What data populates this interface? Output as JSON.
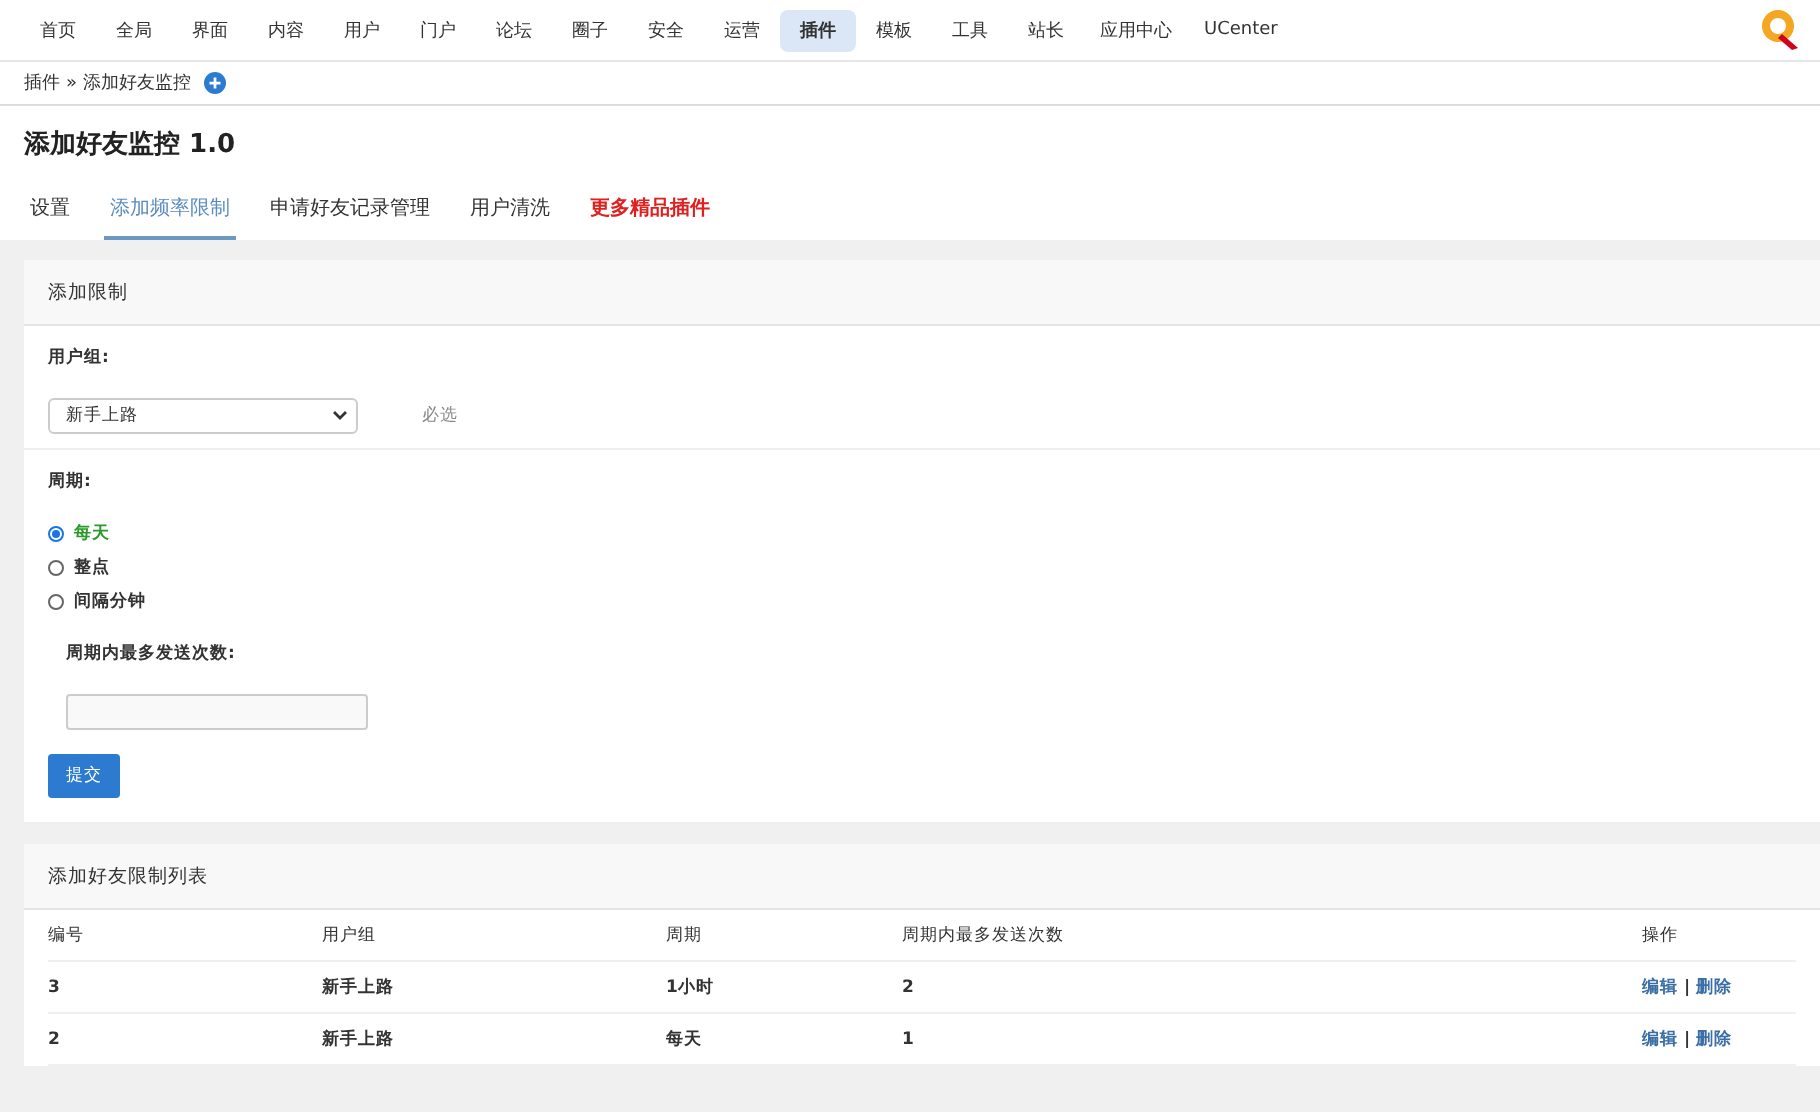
{
  "top_nav": [
    {
      "label": "首页",
      "selected": false
    },
    {
      "label": "全局",
      "selected": false
    },
    {
      "label": "界面",
      "selected": false
    },
    {
      "label": "内容",
      "selected": false
    },
    {
      "label": "用户",
      "selected": false
    },
    {
      "label": "门户",
      "selected": false
    },
    {
      "label": "论坛",
      "selected": false
    },
    {
      "label": "圈子",
      "selected": false
    },
    {
      "label": "安全",
      "selected": false
    },
    {
      "label": "运营",
      "selected": false
    },
    {
      "label": "插件",
      "selected": true
    },
    {
      "label": "模板",
      "selected": false
    },
    {
      "label": "工具",
      "selected": false
    },
    {
      "label": "站长",
      "selected": false
    },
    {
      "label": "应用中心",
      "selected": false
    },
    {
      "label": "UCenter",
      "selected": false
    }
  ],
  "breadcrumb": {
    "parent": "插件",
    "separator": "»",
    "current": "添加好友监控"
  },
  "page_title": "添加好友监控 1.0",
  "tabs": [
    {
      "label": "设置",
      "selected": false,
      "highlight": false
    },
    {
      "label": "添加频率限制",
      "selected": true,
      "highlight": false
    },
    {
      "label": "申请好友记录管理",
      "selected": false,
      "highlight": false
    },
    {
      "label": "用户清洗",
      "selected": false,
      "highlight": false
    },
    {
      "label": "更多精品插件",
      "selected": false,
      "highlight": true
    }
  ],
  "form": {
    "title": "添加限制",
    "user_group_label": "用户组:",
    "user_group_value": "新手上路",
    "user_group_hint": "必选",
    "period_label": "周期:",
    "period_options": [
      {
        "label": "每天",
        "selected": true
      },
      {
        "label": "整点",
        "selected": false
      },
      {
        "label": "间隔分钟",
        "selected": false
      }
    ],
    "max_label": "周期内最多发送次数:",
    "submit": "提交"
  },
  "list": {
    "title": "添加好友限制列表",
    "columns": [
      "编号",
      "用户组",
      "周期",
      "周期内最多发送次数",
      "操作"
    ],
    "rows": [
      {
        "id": "3",
        "group": "新手上路",
        "period": "1小时",
        "max": "2",
        "actions": [
          "编辑",
          "删除"
        ],
        "action_separator": "|"
      },
      {
        "id": "2",
        "group": "新手上路",
        "period": "每天",
        "max": "1",
        "actions": [
          "编辑",
          "删除"
        ],
        "action_separator": "|"
      }
    ]
  }
}
